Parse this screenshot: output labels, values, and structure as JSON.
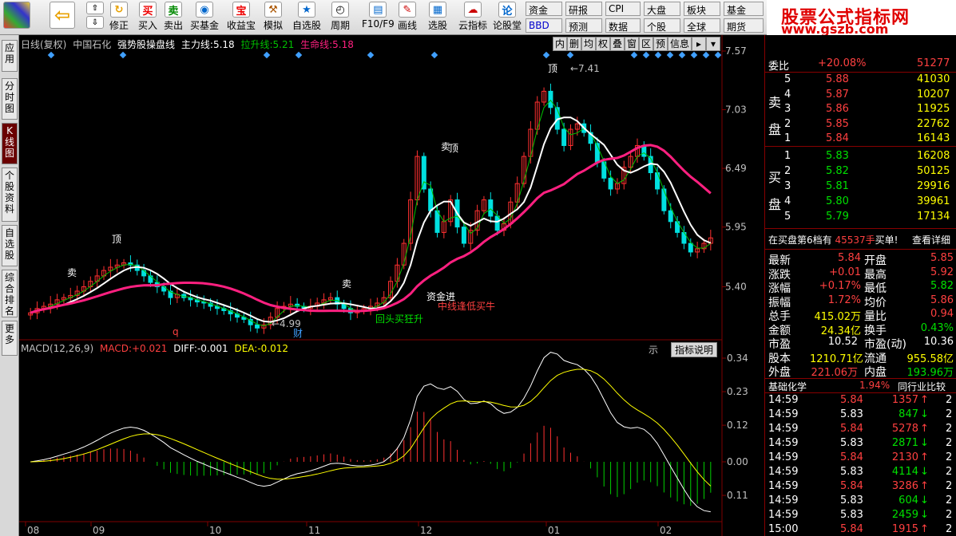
{
  "toolbar": {
    "buttons": [
      {
        "label": "修正",
        "icon": "refresh-icon"
      },
      {
        "label": "买入",
        "icon": "buy-icon"
      },
      {
        "label": "卖出",
        "icon": "sell-icon"
      },
      {
        "label": "买基金",
        "icon": "fund-icon"
      },
      {
        "label": "收益宝",
        "icon": "treasure-icon"
      },
      {
        "label": "模拟",
        "icon": "hammer-icon"
      },
      {
        "label": "自选股",
        "icon": "star-icon"
      },
      {
        "label": "周期",
        "icon": "clock-icon"
      },
      {
        "label": "F10/F9",
        "icon": "document-icon"
      },
      {
        "label": "画线",
        "icon": "pencil-icon"
      },
      {
        "label": "选股",
        "icon": "select-icon"
      },
      {
        "label": "云指标",
        "icon": "cloud-icon"
      },
      {
        "label": "论股堂",
        "icon": "discuss-icon"
      }
    ],
    "small_buttons": [
      "资金",
      "研报",
      "CPI",
      "大盘",
      "板块",
      "基金",
      "BBD",
      "预测",
      "数据",
      "个股",
      "全球",
      "期货"
    ],
    "glyphs": {
      "buy": "买",
      "sell": "卖",
      "bao": "宝",
      "lun": "论"
    }
  },
  "logo": {
    "title": "股票公式指标网",
    "url": "www.gszb.com"
  },
  "left_tabs": [
    "应用",
    "分时图",
    "K线图",
    "个股资料",
    "自选股",
    "综合排名",
    "更多"
  ],
  "chart": {
    "header": {
      "period": "日线(复权)",
      "name": "中国石化",
      "formula": "强势股操盘线",
      "zl_label": "主力线:",
      "zl_value": "5.18",
      "ls_label": "拉升线:",
      "ls_value": "5.21",
      "sm_label": "生命线:",
      "sm_value": "5.18"
    },
    "buttons": [
      "内",
      "删",
      "均",
      "权",
      "叠",
      "窗",
      "区",
      "预",
      "信息",
      "▸",
      "▾"
    ],
    "price_axis": [
      "7.57",
      "7.03",
      "6.49",
      "5.95",
      "5.40"
    ],
    "annotations": {
      "high": "7.41",
      "low": "4.99",
      "ding1": "顶",
      "ding2": "顶",
      "ding3": "顶",
      "mai1": "卖",
      "mai2": "卖",
      "mai3": "卖",
      "signal1": "资金进",
      "signal2": "回头买狂升",
      "signal3": "中线逢低买牛",
      "cai": "财",
      "q": "q"
    },
    "macd_header": {
      "label": "MACD(12,26,9)",
      "macd_label": "MACD:",
      "macd_value": "+0.021",
      "diff_label": "DIFF:",
      "diff_value": "-0.001",
      "dea_label": "DEA:",
      "dea_value": "-0.012"
    },
    "macd_tab": "示",
    "indicator_button": "指标说明",
    "macd_axis": [
      "0.34",
      "0.23",
      "0.12",
      "0.00",
      "0.11"
    ],
    "months": [
      "08",
      "09",
      "10",
      "11",
      "12",
      "01",
      "02"
    ],
    "colors": {
      "up": "#ff3030",
      "down": "#00e0e0",
      "zl": "#ffffff",
      "ls": "#00c000",
      "sm": "#ff2080",
      "grid": "#800000"
    }
  },
  "chart_data": {
    "type": "candlestick",
    "close": [
      5.16,
      5.2,
      5.22,
      5.24,
      5.28,
      5.3,
      5.32,
      5.36,
      5.4,
      5.45,
      5.5,
      5.55,
      5.58,
      5.6,
      5.62,
      5.6,
      5.55,
      5.5,
      5.44,
      5.4,
      5.36,
      5.3,
      5.33,
      5.3,
      5.28,
      5.26,
      5.25,
      5.22,
      5.2,
      5.18,
      5.15,
      5.12,
      5.1,
      5.05,
      5.02,
      5.05,
      5.12,
      5.2,
      5.22,
      5.24,
      5.22,
      5.2,
      5.22,
      5.25,
      5.28,
      5.3,
      5.24,
      5.2,
      5.16,
      5.18,
      5.2,
      5.22,
      5.25,
      5.3,
      5.45,
      5.6,
      5.8,
      6.2,
      6.6,
      6.3,
      6.1,
      5.9,
      6.0,
      6.2,
      5.95,
      5.8,
      5.92,
      6.1,
      6.2,
      6.05,
      5.92,
      5.98,
      6.18,
      6.35,
      6.6,
      6.85,
      7.1,
      7.2,
      7.05,
      6.85,
      6.7,
      6.85,
      6.9,
      6.82,
      6.72,
      6.55,
      6.4,
      6.3,
      6.35,
      6.5,
      6.6,
      6.7,
      6.6,
      6.45,
      6.3,
      6.1,
      6.0,
      5.9,
      5.8,
      5.72,
      5.75,
      5.8,
      5.85
    ]
  },
  "right": {
    "wb_label": "委比",
    "wb_pct": "+20.08%",
    "wb_val": "51277",
    "sell_label": "卖盘",
    "buy_label": "买盘",
    "asks": [
      {
        "n": "5",
        "p": "5.88",
        "v": "41030"
      },
      {
        "n": "4",
        "p": "5.87",
        "v": "10207"
      },
      {
        "n": "3",
        "p": "5.86",
        "v": "11925"
      },
      {
        "n": "2",
        "p": "5.85",
        "v": "22762"
      },
      {
        "n": "1",
        "p": "5.84",
        "v": "16143"
      }
    ],
    "bids": [
      {
        "n": "1",
        "p": "5.83",
        "v": "16208"
      },
      {
        "n": "2",
        "p": "5.82",
        "v": "50125"
      },
      {
        "n": "3",
        "p": "5.81",
        "v": "29916"
      },
      {
        "n": "4",
        "p": "5.80",
        "v": "39961"
      },
      {
        "n": "5",
        "p": "5.79",
        "v": "17134"
      }
    ],
    "notice": {
      "a": "在买盘第6档有",
      "vol": "45537手",
      "b": "买单!",
      "link": "查看详细"
    },
    "stats": [
      [
        "最新",
        "5.84",
        "开盘",
        "5.85"
      ],
      [
        "涨跌",
        "+0.01",
        "最高",
        "5.92"
      ],
      [
        "涨幅",
        "+0.17%",
        "最低",
        "5.82"
      ],
      [
        "振幅",
        "1.72%",
        "均价",
        "5.86"
      ],
      [
        "总手",
        "415.02万",
        "量比",
        "0.94"
      ],
      [
        "金额",
        "24.34亿",
        "换手",
        "0.43%"
      ],
      [
        "市盈",
        "10.52",
        "市盈(动)",
        "10.36"
      ],
      [
        "股本",
        "1210.71亿",
        "流通",
        "955.58亿"
      ],
      [
        "外盘",
        "221.06万",
        "内盘",
        "193.96万"
      ]
    ],
    "sector": {
      "name": "基础化学",
      "pct": "1.94%",
      "cmp": "同行业比较"
    },
    "ticks": [
      {
        "t": "14:59",
        "p": "5.84",
        "v": "1357",
        "d": "up",
        "n": "2"
      },
      {
        "t": "14:59",
        "p": "5.83",
        "v": "847",
        "d": "down",
        "n": "2"
      },
      {
        "t": "14:59",
        "p": "5.84",
        "v": "5278",
        "d": "up",
        "n": "2"
      },
      {
        "t": "14:59",
        "p": "5.83",
        "v": "2871",
        "d": "down",
        "n": "2"
      },
      {
        "t": "14:59",
        "p": "5.84",
        "v": "2130",
        "d": "up",
        "n": "2"
      },
      {
        "t": "14:59",
        "p": "5.83",
        "v": "4114",
        "d": "down",
        "n": "2"
      },
      {
        "t": "14:59",
        "p": "5.84",
        "v": "3286",
        "d": "up",
        "n": "2"
      },
      {
        "t": "14:59",
        "p": "5.83",
        "v": "604",
        "d": "down",
        "n": "2"
      },
      {
        "t": "14:59",
        "p": "5.83",
        "v": "2459",
        "d": "down",
        "n": "2"
      },
      {
        "t": "15:00",
        "p": "5.84",
        "v": "1915",
        "d": "up",
        "n": "2"
      }
    ]
  }
}
